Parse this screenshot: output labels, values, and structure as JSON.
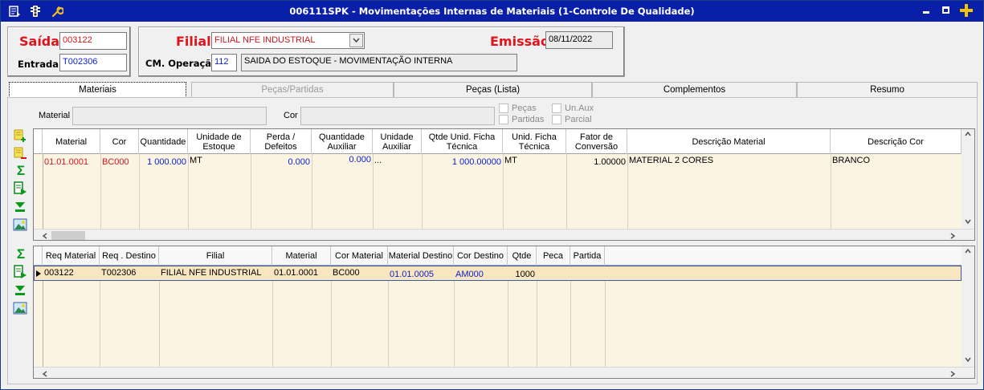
{
  "window": {
    "title": "006111SPK - Movimentações Internas de Materiais (1-Controle De Qualidade)"
  },
  "header": {
    "saida_label": "Saída",
    "saida_value": "003122",
    "entrada_label": "Entrada",
    "entrada_value": "T002306",
    "filial_label": "Filial",
    "filial_value": "FILIAL NFE INDUSTRIAL",
    "emissao_label": "Emissão",
    "emissao_value": "08/11/2022",
    "cmop_label": "CM. Operação",
    "cmop_code": "112",
    "cmop_desc": "SAIDA DO ESTOQUE - MOVIMENTAÇÃO INTERNA"
  },
  "tabs": [
    {
      "label": "Materiais"
    },
    {
      "label": "Peças/Partidas"
    },
    {
      "label": "Peças (Lista)"
    },
    {
      "label": "Complementos"
    },
    {
      "label": "Resumo"
    }
  ],
  "filters": {
    "material_label": "Material",
    "cor_label": "Cor",
    "pecas_label": "Peças",
    "partidas_label": "Partidas",
    "unaux_label": "Un.Aux",
    "parcial_label": "Parcial"
  },
  "grid1": {
    "headers": [
      "Material",
      "Cor",
      "Quantidade",
      "Unidade de Estoque",
      "Perda / Defeitos",
      "Quantidade Auxiliar",
      "Unidade Auxiliar",
      "Qtde Unid. Ficha Técnica",
      "Unid. Ficha Técnica",
      "Fator de Conversão",
      "Descrição Material",
      "Descrição Cor"
    ],
    "row": [
      "01.01.0001",
      "BC000",
      "1 000.000",
      "MT",
      "0.000",
      "0.000",
      "...",
      "1 000.00000",
      "MT",
      "1.00000",
      "MATERIAL 2 CORES",
      "BRANCO"
    ]
  },
  "grid2": {
    "headers": [
      "Req Material",
      "Req . Destino",
      "Filial",
      "Material",
      "Cor Material",
      "Material Destino",
      "Cor Destino",
      "Qtde",
      "Peca",
      "Partida"
    ],
    "row": [
      "003122",
      "T002306",
      "FILIAL NFE INDUSTRIAL",
      "01.01.0001",
      "BC000",
      "01.01.0005",
      "AM000",
      "1000",
      "",
      ""
    ]
  },
  "colors": {
    "titlebar": "#0a1fa8",
    "red_label": "#e0141e",
    "blue_value": "#0a1fc8",
    "grid_bg": "#fcf4e2"
  },
  "icons": [
    "menu-icon",
    "traffic-light-icon",
    "wrench-icon",
    "minimize-icon",
    "maximize-icon",
    "plus-icon",
    "add-row-icon",
    "remove-row-icon",
    "sigma-icon",
    "export-icon",
    "collapse-icon",
    "image-icon"
  ]
}
